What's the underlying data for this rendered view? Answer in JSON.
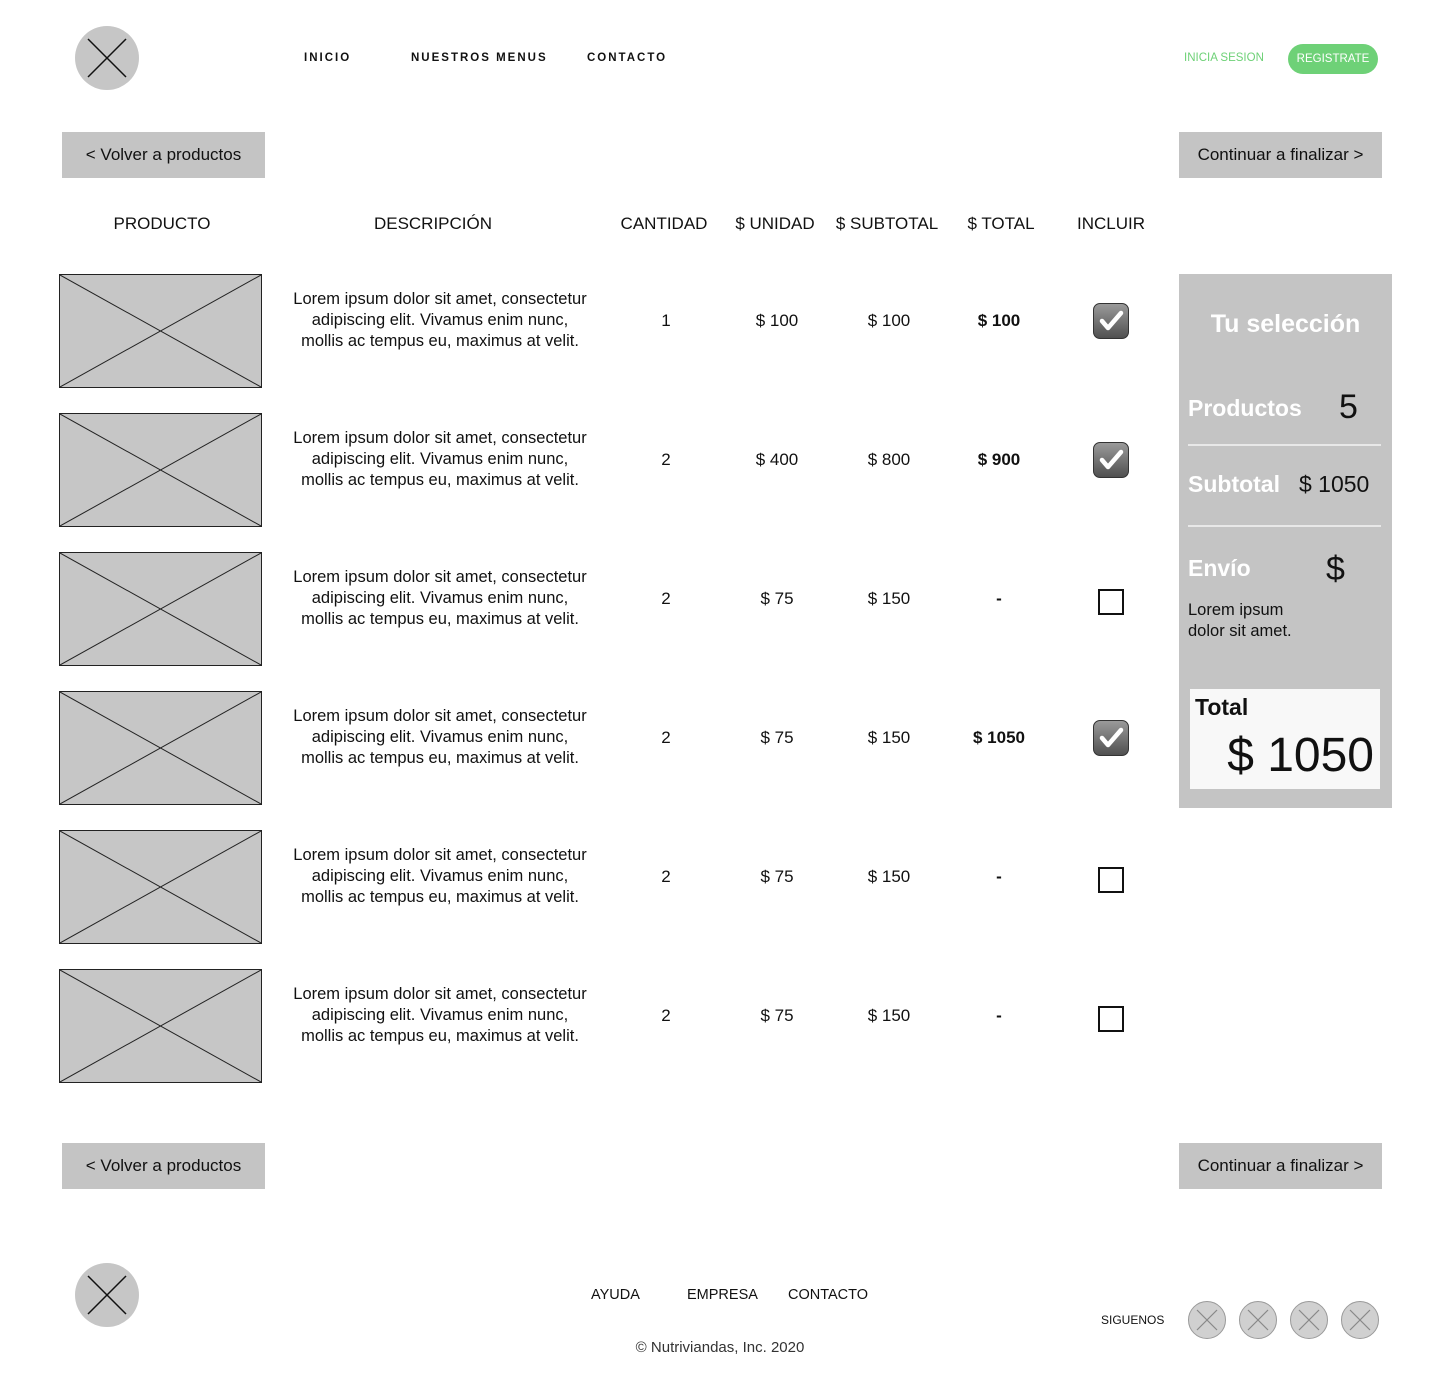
{
  "header": {
    "nav": [
      "INICIO",
      "NUESTROS MENUS",
      "CONTACTO"
    ],
    "login_label": "INICIA SESION",
    "register_label": "REGISTRATE"
  },
  "actions": {
    "back_label": "< Volver a productos",
    "continue_label": "Continuar a finalizar >"
  },
  "table": {
    "columns": [
      "PRODUCTO",
      "DESCRIPCIÓN",
      "CANTIDAD",
      "$ UNIDAD",
      "$ SUBTOTAL",
      "$ TOTAL",
      "INCLUIR"
    ],
    "rows": [
      {
        "description": "Lorem ipsum dolor sit amet, consectetur adipiscing elit. Vivamus enim nunc, mollis ac tempus eu, maximus at velit.",
        "quantity": "1",
        "unit": "$ 100",
        "subtotal": "$ 100",
        "total": "$ 100",
        "included": true
      },
      {
        "description": "Lorem ipsum dolor sit amet, consectetur adipiscing elit. Vivamus enim nunc, mollis ac tempus eu, maximus at velit.",
        "quantity": "2",
        "unit": "$ 400",
        "subtotal": "$ 800",
        "total": "$ 900",
        "included": true
      },
      {
        "description": "Lorem ipsum dolor sit amet, consectetur adipiscing elit. Vivamus enim nunc, mollis ac tempus eu, maximus at velit.",
        "quantity": "2",
        "unit": "$ 75",
        "subtotal": "$ 150",
        "total": "-",
        "included": false
      },
      {
        "description": "Lorem ipsum dolor sit amet, consectetur adipiscing elit. Vivamus enim nunc, mollis ac tempus eu, maximus at velit.",
        "quantity": "2",
        "unit": "$ 75",
        "subtotal": "$ 150",
        "total": "$ 1050",
        "included": true
      },
      {
        "description": "Lorem ipsum dolor sit amet, consectetur adipiscing elit. Vivamus enim nunc, mollis ac tempus eu, maximus at velit.",
        "quantity": "2",
        "unit": "$ 75",
        "subtotal": "$ 150",
        "total": "-",
        "included": false
      },
      {
        "description": "Lorem ipsum dolor sit amet, consectetur adipiscing elit. Vivamus enim nunc, mollis ac tempus eu, maximus at velit.",
        "quantity": "2",
        "unit": "$ 75",
        "subtotal": "$ 150",
        "total": "-",
        "included": false
      }
    ]
  },
  "summary": {
    "title": "Tu selección",
    "products_label": "Productos",
    "products_value": "5",
    "subtotal_label": "Subtotal",
    "subtotal_value": "$ 1050",
    "shipping_label": "Envío",
    "shipping_value": "$",
    "shipping_note": "Lorem ipsum dolor sit amet.",
    "total_label": "Total",
    "total_value": "$ 1050"
  },
  "footer": {
    "links": [
      "AYUDA",
      "EMPRESA",
      "CONTACTO"
    ],
    "copyright": "© Nutriviandas, Inc. 2020",
    "follow_label": "SIGUENOS"
  },
  "colors": {
    "accent": "#6ed177",
    "placeholder": "#c4c4c4",
    "panel_text": "#ffffff"
  }
}
